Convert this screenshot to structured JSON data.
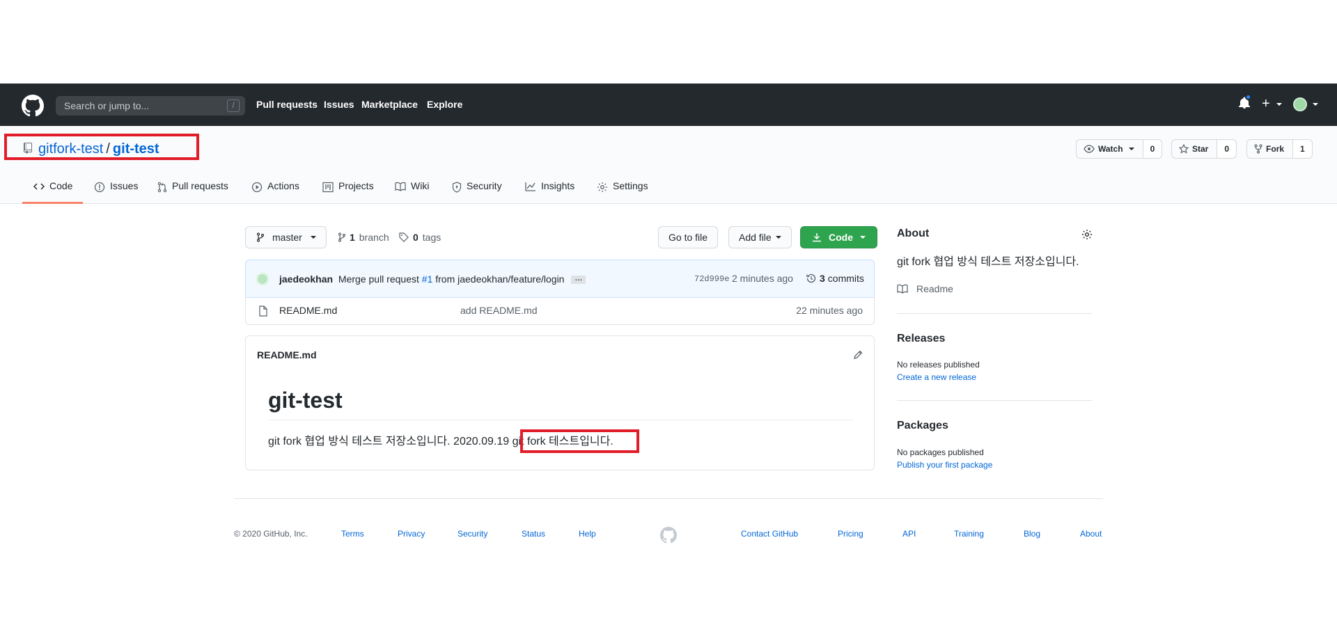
{
  "header": {
    "search_placeholder": "Search or jump to...",
    "search_shortcut": "/",
    "nav": [
      "Pull requests",
      "Issues",
      "Marketplace",
      "Explore"
    ],
    "plus": "+",
    "colors": {
      "bg": "#24292e",
      "notification_dot": "#2188ff"
    }
  },
  "repo": {
    "owner": "gitfork-test",
    "separator": "/",
    "name": "git-test",
    "watch_label": "Watch",
    "watch_count": "0",
    "star_label": "Star",
    "star_count": "0",
    "fork_label": "Fork",
    "fork_count": "1"
  },
  "tabs": [
    "Code",
    "Issues",
    "Pull requests",
    "Actions",
    "Projects",
    "Wiki",
    "Security",
    "Insights",
    "Settings"
  ],
  "selected_tab": "Code",
  "toolbar": {
    "branch": "master",
    "branch_count": "1",
    "branch_word": "branch",
    "tag_count": "0",
    "tag_word": "tags",
    "go_to_file": "Go to file",
    "add_file": "Add file",
    "code": "Code"
  },
  "commit": {
    "author": "jaedeokhan",
    "msg_before": "Merge pull request",
    "pr_link": "#1",
    "msg_after": "from jaedeokhan/feature/login",
    "ellipsis": "…",
    "sha": "72d999e",
    "time": "2 minutes ago",
    "commits_count": "3",
    "commits_word": "commits"
  },
  "files": [
    {
      "name": "README.md",
      "message": "add README.md",
      "time": "22 minutes ago"
    }
  ],
  "readme": {
    "filename": "README.md",
    "heading": "git-test",
    "body_plain": "git fork 협업 방식 테스트 저장소입니다. 2020.09.19",
    "body_highlighted": "git fork 테스트입니다."
  },
  "about": {
    "title": "About",
    "description": "git fork 협업 방식 테스트 저장소입니다.",
    "readme_link": "Readme",
    "releases_title": "Releases",
    "releases_none": "No releases published",
    "releases_link": "Create a new release",
    "packages_title": "Packages",
    "packages_none": "No packages published",
    "packages_link": "Publish your first package"
  },
  "footer": {
    "copyright": "© 2020 GitHub, Inc.",
    "left_links": [
      "Terms",
      "Privacy",
      "Security",
      "Status",
      "Help"
    ],
    "right_links": [
      "Contact GitHub",
      "Pricing",
      "API",
      "Training",
      "Blog",
      "About"
    ]
  },
  "annotation_color": "#e21d2a"
}
